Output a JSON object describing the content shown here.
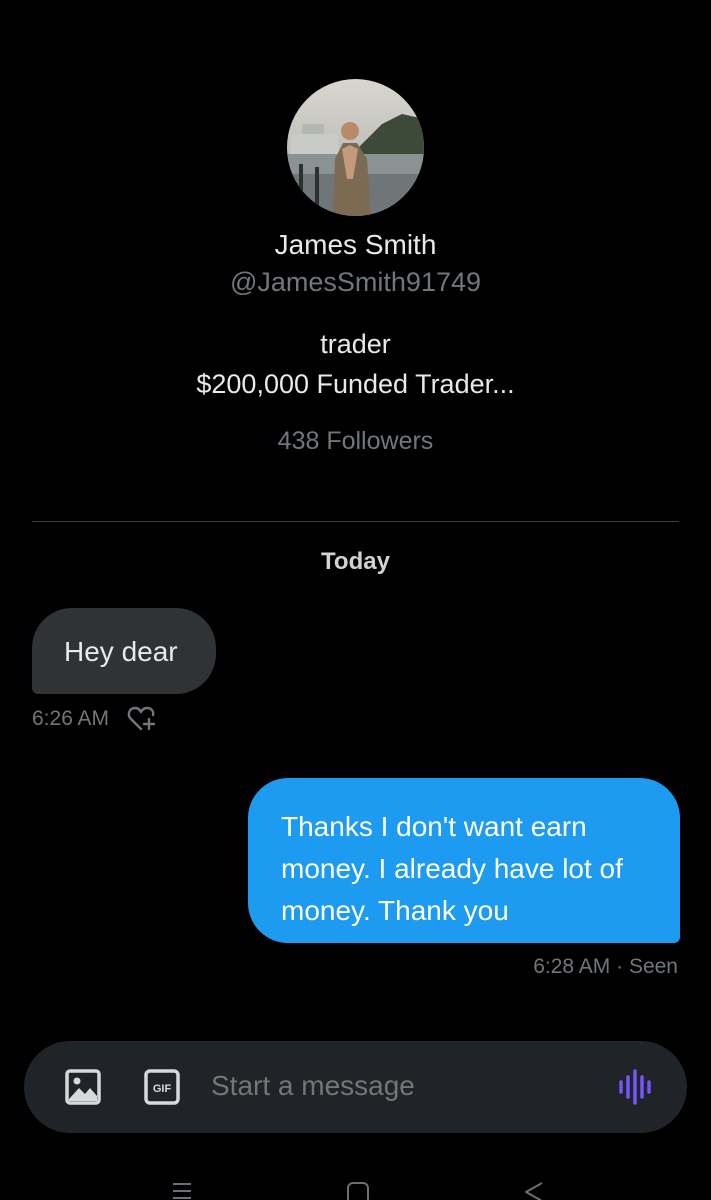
{
  "profile": {
    "name": "James Smith",
    "handle": "@JamesSmith91749",
    "bio_line1": "trader",
    "bio_line2": "$200,000 Funded Trader...",
    "followers": "438 Followers"
  },
  "conversation": {
    "date_separator": "Today",
    "messages": [
      {
        "direction": "incoming",
        "text": "Hey dear",
        "time": "6:26 AM"
      },
      {
        "direction": "outgoing",
        "lines": [
          "Thanks I don't want earn",
          "money. I already have lot of",
          "money. Thank you"
        ],
        "status": "6:28 AM · Seen"
      }
    ]
  },
  "composer": {
    "placeholder": "Start a message",
    "media_icon": "image-icon",
    "gif_icon": "gif-icon",
    "voice_icon": "voice-message-icon"
  },
  "colors": {
    "background": "#000000",
    "incoming_bubble": "#2f3336",
    "outgoing_bubble": "#1d9bf0",
    "secondary_text": "#71767b",
    "accent_voice": "#7856ff"
  }
}
